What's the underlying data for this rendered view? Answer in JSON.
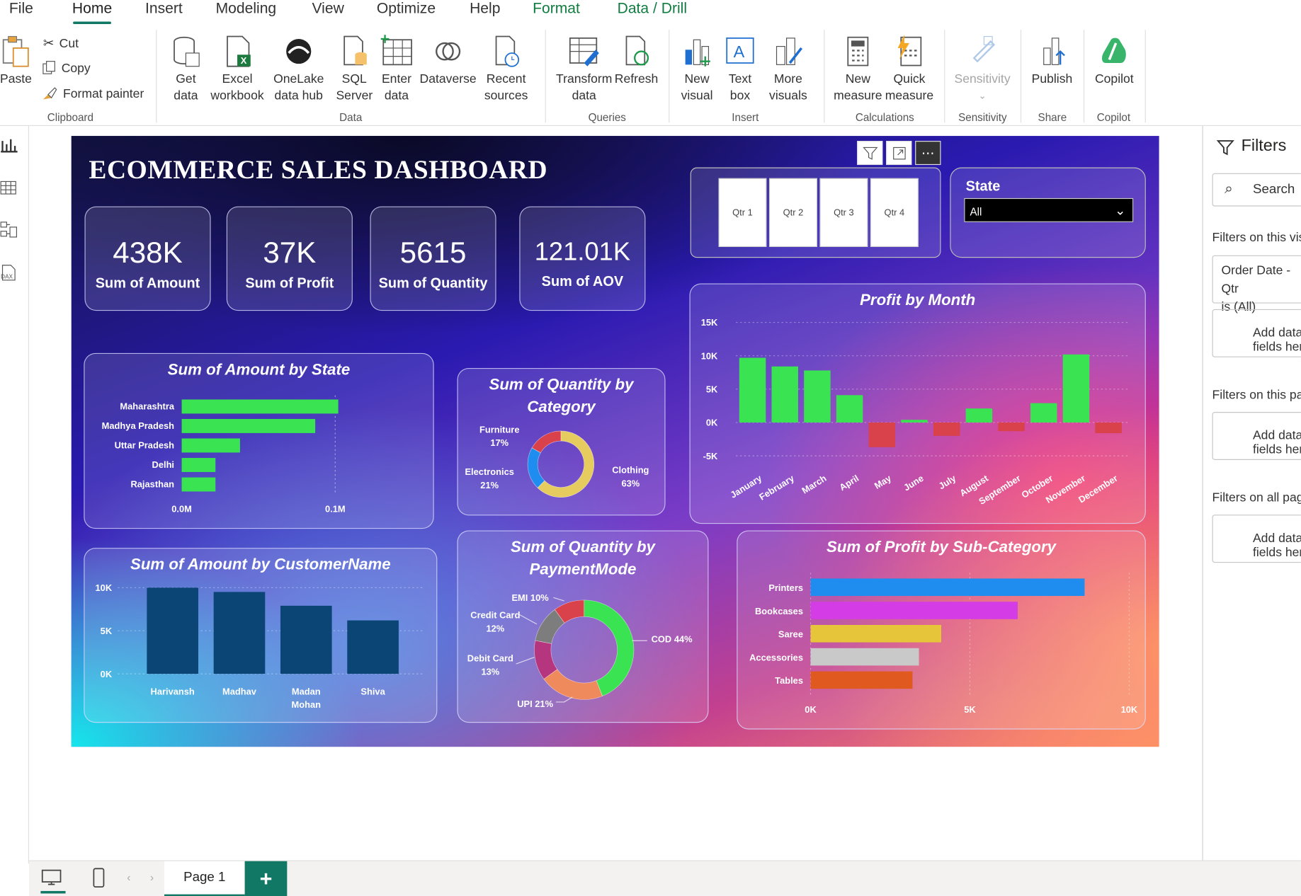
{
  "ribbon": {
    "tabs": [
      "File",
      "Home",
      "Insert",
      "Modeling",
      "View",
      "Optimize",
      "Help",
      "Format",
      "Data / Drill"
    ],
    "clipboard": {
      "paste": "Paste",
      "cut": "Cut",
      "copy": "Copy",
      "format_painter": "Format painter",
      "group": "Clipboard"
    },
    "data": {
      "get_data": "Get data",
      "excel": "Excel workbook",
      "onelake": "OneLake data hub",
      "sql": "SQL Server",
      "enter": "Enter data",
      "dataverse": "Dataverse",
      "recent": "Recent sources",
      "group": "Data"
    },
    "queries": {
      "transform": "Transform data",
      "refresh": "Refresh",
      "group": "Queries"
    },
    "insert": {
      "new_visual": "New visual",
      "text_box": "Text box",
      "more_visuals": "More visuals",
      "group": "Insert"
    },
    "calculations": {
      "new_measure": "New measure",
      "quick_measure": "Quick measure",
      "group": "Calculations"
    },
    "sensitivity": {
      "label": "Sensitivity",
      "group": "Sensitivity"
    },
    "share": {
      "publish": "Publish",
      "group": "Share"
    },
    "copilot": {
      "label": "Copilot",
      "group": "Copilot"
    }
  },
  "dashboard": {
    "title": "ECOMMERCE SALES DASHBOARD",
    "kpis": [
      {
        "value": "438K",
        "label": "Sum of Amount"
      },
      {
        "value": "37K",
        "label": "Sum of Profit"
      },
      {
        "value": "5615",
        "label": "Sum of Quantity"
      },
      {
        "value": "121.01K",
        "label": "Sum of AOV"
      }
    ],
    "quarters": [
      "Qtr 1",
      "Qtr 2",
      "Qtr 3",
      "Qtr 4"
    ],
    "state_slicer": {
      "label": "State",
      "value": "All"
    }
  },
  "chart_data": [
    {
      "type": "bar",
      "title": "Sum of Amount by State",
      "orientation": "horizontal",
      "categories": [
        "Maharashtra",
        "Madhya Pradesh",
        "Uttar Pradesh",
        "Delhi",
        "Rajasthan"
      ],
      "values": [
        0.102,
        0.087,
        0.038,
        0.022,
        0.022
      ],
      "xticks": [
        "0.0M",
        "0.1M"
      ],
      "xlim": [
        0,
        0.1
      ],
      "color": "#39e352"
    },
    {
      "type": "pie",
      "title": "Sum of Quantity by Category",
      "donut": true,
      "labels": [
        "Clothing",
        "Electronics",
        "Furniture"
      ],
      "values": [
        63,
        21,
        17
      ],
      "display": [
        "Clothing\n63%",
        "Electronics\n21%",
        "Furniture\n17%"
      ],
      "colors": [
        "#e6cc5e",
        "#1f8cf0",
        "#d9414b"
      ]
    },
    {
      "type": "bar",
      "title": "Profit by Month",
      "categories": [
        "January",
        "February",
        "March",
        "April",
        "May",
        "June",
        "July",
        "August",
        "September",
        "October",
        "November",
        "December"
      ],
      "values": [
        9700,
        8400,
        7800,
        4100,
        -3700,
        400,
        -2000,
        2100,
        -1300,
        2900,
        10200,
        -1600
      ],
      "yticks": [
        "15K",
        "10K",
        "5K",
        "0K",
        "-5K"
      ],
      "ylim": [
        -5000,
        15000
      ],
      "colors": {
        "positive": "#39e352",
        "negative": "#d9414b"
      }
    },
    {
      "type": "bar",
      "title": "Sum of Amount by CustomerName",
      "categories": [
        "Harivansh",
        "Madhav",
        "Madan Mohan",
        "Shiva"
      ],
      "values": [
        10000,
        9500,
        7900,
        6200
      ],
      "yticks": [
        "10K",
        "5K",
        "0K"
      ],
      "ylim": [
        0,
        10000
      ],
      "color": "#0a4575"
    },
    {
      "type": "pie",
      "title": "Sum of Quantity by PaymentMode",
      "donut": true,
      "labels": [
        "COD",
        "UPI",
        "Debit Card",
        "Credit Card",
        "EMI"
      ],
      "values": [
        44,
        21,
        13,
        12,
        10
      ],
      "display": [
        "COD 44%",
        "UPI 21%",
        "Debit Card\n13%",
        "Credit Card\n12%",
        "EMI 10%"
      ],
      "colors": [
        "#39e352",
        "#ee8a5b",
        "#b5367e",
        "#7d7d7d",
        "#d9414b"
      ]
    },
    {
      "type": "bar",
      "title": "Sum of Profit by Sub-Category",
      "orientation": "horizontal",
      "categories": [
        "Printers",
        "Bookcases",
        "Saree",
        "Accessories",
        "Tables"
      ],
      "values": [
        8600,
        6500,
        4100,
        3400,
        3200
      ],
      "xticks": [
        "0K",
        "5K",
        "10K"
      ],
      "xlim": [
        0,
        10000
      ],
      "colors": [
        "#1f8cf0",
        "#d43ce6",
        "#e6c53a",
        "#c9c9c9",
        "#e05a20"
      ]
    }
  ],
  "filters": {
    "title": "Filters",
    "search": "Search",
    "on_visual": "Filters on this visual",
    "order_date": "Order Date - Qtr",
    "is_all": "is (All)",
    "add_data": "Add data fields here",
    "on_page": "Filters on this page",
    "on_all": "Filters on all pages"
  },
  "bottom": {
    "page": "Page 1",
    "add": "+"
  }
}
